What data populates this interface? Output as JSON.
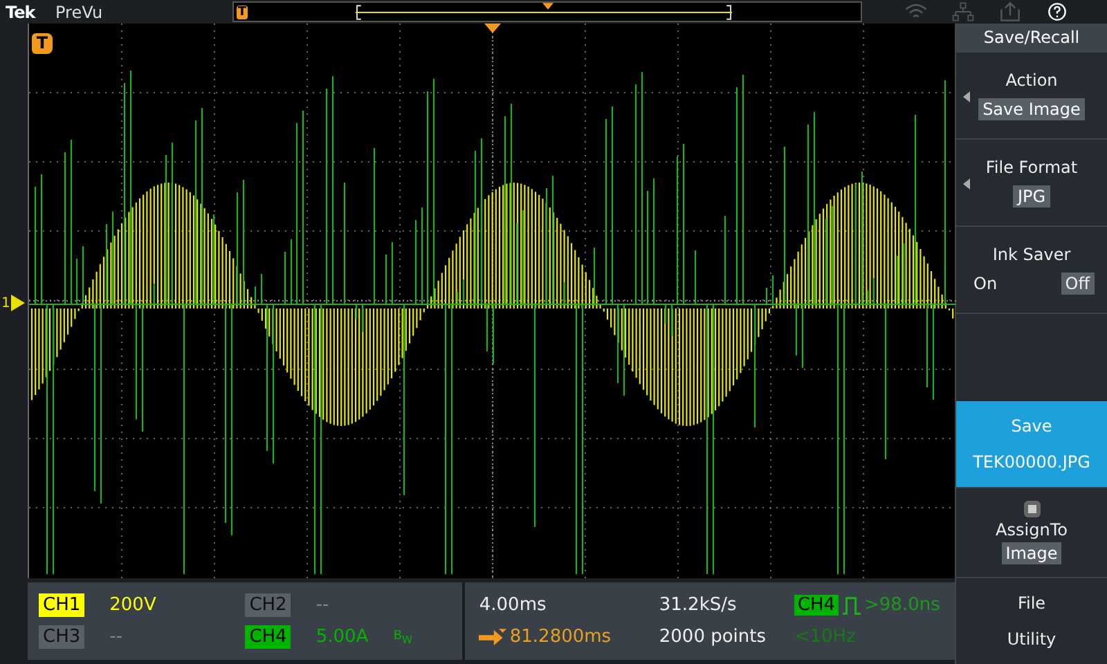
{
  "top_bar": {
    "brand": "Tek",
    "mode": "PreVu",
    "trigger_label": "T"
  },
  "graticule": {
    "trigger_label": "T",
    "channel_marker": "1"
  },
  "menu": {
    "title": "Save/Recall",
    "sections": [
      {
        "kind": "option",
        "label": "Action",
        "value": "Save Image"
      },
      {
        "kind": "option",
        "label": "File Format",
        "value": "JPG"
      },
      {
        "kind": "toggle",
        "label": "Ink Saver",
        "options": [
          {
            "label": "On",
            "selected": false
          },
          {
            "label": "Off",
            "selected": true
          }
        ]
      },
      {
        "kind": "button",
        "label": "Save",
        "value": "TEK00000.JPG"
      },
      {
        "kind": "assign",
        "label": "AssignTo",
        "value": "Image"
      },
      {
        "kind": "plain",
        "label": "File",
        "value": "Utility"
      }
    ]
  },
  "channels": [
    {
      "label": "CH1",
      "value": "200V",
      "on": true,
      "color": "#ffff00"
    },
    {
      "label": "CH2",
      "value": "--",
      "on": false,
      "color": "#5a6068"
    },
    {
      "label": "CH3",
      "value": "--",
      "on": false,
      "color": "#5a6068"
    },
    {
      "label": "CH4",
      "value": "5.00A",
      "on": true,
      "color": "#00b400",
      "bandwidth": "B$_{W}$"
    }
  ],
  "horizontal": {
    "scale": "4.00ms",
    "sample_rate": "31.2kS/s",
    "position": "81.2800ms",
    "record_length": "2000 points"
  },
  "trigger": {
    "source": "CH4",
    "level": ">98.0ns",
    "frequency": "<10Hz"
  }
}
